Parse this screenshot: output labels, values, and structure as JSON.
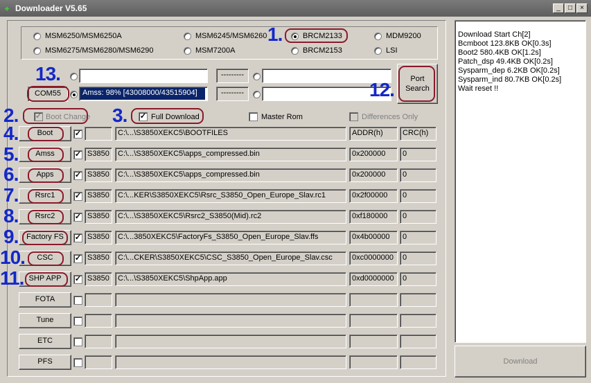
{
  "window": {
    "title": "Downloader V5.65",
    "min": "_",
    "max": "□",
    "close": "×"
  },
  "chips": [
    {
      "label": "MSM6250/MSM6250A",
      "selected": false
    },
    {
      "label": "MSM6245/MSM6260",
      "selected": false
    },
    {
      "label": "BRCM2133",
      "selected": true
    },
    {
      "label": "MDM9200",
      "selected": false
    },
    {
      "label": "MSM6275/MSM6280/MSM6290",
      "selected": false
    },
    {
      "label": "MSM7200A",
      "selected": false
    },
    {
      "label": "BRCM2153",
      "selected": false
    },
    {
      "label": "LSI",
      "selected": false
    }
  ],
  "port": {
    "com_label": "COM55",
    "progress_text": "Amss:  98% [43008000/43515904]",
    "progress_pct": 98,
    "dash": "---------",
    "search_label": "Port\nSearch"
  },
  "options": {
    "boot_change": "Boot Change",
    "full_download": "Full Download",
    "master_rom": "Master Rom",
    "differences_only": "Differences Only"
  },
  "headers": {
    "addr": "ADDR(h)",
    "crc": "CRC(h)"
  },
  "rows": [
    {
      "btn": "Boot",
      "checked": true,
      "model": "",
      "path": "C:\\...\\S3850XEKC5\\BOOTFILES",
      "addr": "ADDR(h)",
      "crc": "CRC(h)"
    },
    {
      "btn": "Amss",
      "checked": true,
      "model": "S3850",
      "path": "C:\\...\\S3850XEKC5\\apps_compressed.bin",
      "addr": "0x200000",
      "crc": "0"
    },
    {
      "btn": "Apps",
      "checked": true,
      "model": "S3850",
      "path": "C:\\...\\S3850XEKC5\\apps_compressed.bin",
      "addr": "0x200000",
      "crc": "0"
    },
    {
      "btn": "Rsrc1",
      "checked": true,
      "model": "S3850",
      "path": "C:\\...KER\\S3850XEKC5\\Rsrc_S3850_Open_Europe_Slav.rc1",
      "addr": "0x2f00000",
      "crc": "0"
    },
    {
      "btn": "Rsrc2",
      "checked": true,
      "model": "S3850",
      "path": "C:\\...\\S3850XEKC5\\Rsrc2_S3850(Mid).rc2",
      "addr": "0xf180000",
      "crc": "0"
    },
    {
      "btn": "Factory FS",
      "checked": true,
      "model": "S3850",
      "path": "C:\\...3850XEKC5\\FactoryFs_S3850_Open_Europe_Slav.ffs",
      "addr": "0x4b00000",
      "crc": "0"
    },
    {
      "btn": "CSC",
      "checked": true,
      "model": "S3850",
      "path": "C:\\...CKER\\S3850XEKC5\\CSC_S3850_Open_Europe_Slav.csc",
      "addr": "0xc0000000",
      "crc": "0"
    },
    {
      "btn": "SHP APP",
      "checked": true,
      "model": "S3850",
      "path": "C:\\...\\S3850XEKC5\\ShpApp.app",
      "addr": "0xd0000000",
      "crc": "0"
    },
    {
      "btn": "FOTA",
      "checked": false,
      "model": "",
      "path": "",
      "addr": "",
      "crc": ""
    },
    {
      "btn": "Tune",
      "checked": false,
      "model": "",
      "path": "",
      "addr": "",
      "crc": ""
    },
    {
      "btn": "ETC",
      "checked": false,
      "model": "",
      "path": "",
      "addr": "",
      "crc": ""
    },
    {
      "btn": "PFS",
      "checked": false,
      "model": "",
      "path": "",
      "addr": "",
      "crc": ""
    }
  ],
  "log": [
    "Download Start Ch[2]",
    "Bcmboot 123.8KB OK[0.3s]",
    "Boot2 580.4KB OK[1.2s]",
    "Patch_dsp 49.4KB OK[0.2s]",
    "Sysparm_dep 6.2KB OK[0.2s]",
    "Sysparm_ind 80.7KB OK[0.2s]",
    "Wait reset !!"
  ],
  "download_label": "Download",
  "annotations": [
    "1.",
    "2.",
    "3.",
    "4.",
    "5.",
    "6.",
    "7.",
    "8.",
    "9.",
    "10.",
    "11.",
    "12.",
    "13."
  ],
  "colors": {
    "annotation_number": "#1428c8",
    "annotation_circle": "#8b1a2b",
    "progress": "#0a246a"
  }
}
